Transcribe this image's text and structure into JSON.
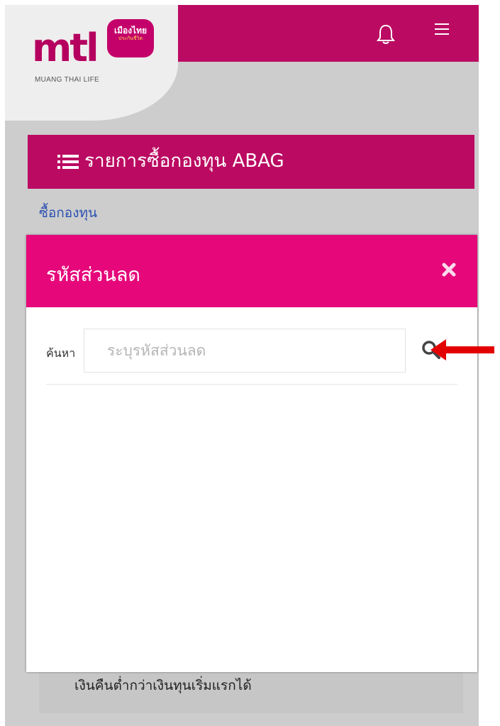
{
  "topbar": {
    "logo_text": "mtl",
    "logo_badge_line1": "เมืองไทย",
    "logo_badge_line2": "ประกันชีวิต",
    "logo_subtitle": "MUANG THAI LIFE",
    "bell_icon": "bell-icon",
    "menu_icon": "hamburger-menu-icon",
    "color": "#bb0a62"
  },
  "page": {
    "header_icon": "list-icon",
    "title": "รายการซื้อกองทุน ABAG",
    "buy_link": "ซื้อกองทุน",
    "behind_text": "...",
    "bottom_note": "เงินคืนต่ำกว่าเงินทุนเริ่มแรกได้"
  },
  "modal": {
    "title": "รหัสส่วนลด",
    "close_icon": "close-icon",
    "search_label": "ค้นหา",
    "search_placeholder": "ระบุรหัสส่วนลด",
    "search_value": "",
    "search_icon": "search-icon",
    "header_color": "#e6087b"
  },
  "annotation": {
    "arrow_color": "#e30000",
    "arrow_icon": "arrow-left-icon"
  }
}
